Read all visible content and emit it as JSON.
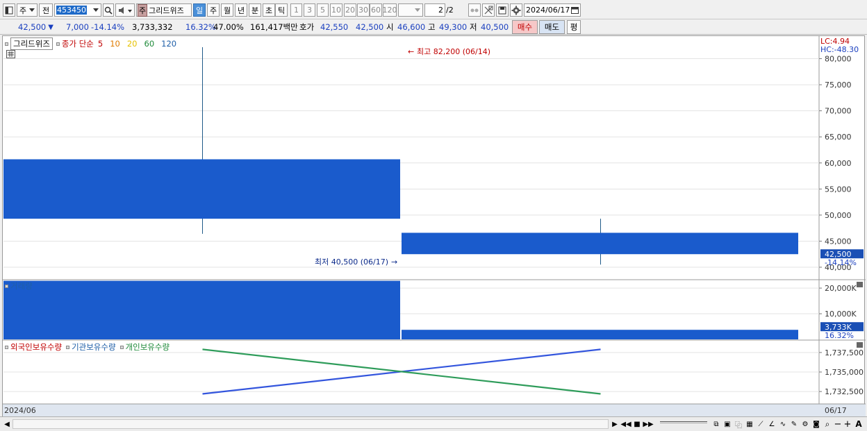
{
  "toolbar": {
    "market_label": "주",
    "prev_label": "전",
    "code_value": "453450",
    "name_prefix": "주",
    "stock_name": "그리드위즈",
    "periods": [
      "일",
      "주",
      "월",
      "년",
      "분",
      "초",
      "틱"
    ],
    "selected_period": "일",
    "intervals": [
      "1",
      "3",
      "5",
      "10",
      "20",
      "30",
      "60",
      "120"
    ],
    "page": "2",
    "page_total": "/2",
    "date_value": "2024/06/17"
  },
  "quote": {
    "price": "42,500",
    "change": "7,000",
    "change_pct": "-14.14%",
    "volume": "3,733,332",
    "volume_pct": "16.32%",
    "ratio": "47.00%",
    "amount": "161,417백만",
    "bid_label": "호가",
    "ask": "42,550",
    "bid": "42,500",
    "open_label": "시",
    "open": "46,600",
    "high_label": "고",
    "high": "49,300",
    "low_label": "저",
    "low": "40,500",
    "buy_label": "매수",
    "sell_label": "매도",
    "avg_label": "평"
  },
  "price_panel": {
    "legend_name": "그리드위즈",
    "ma_label": "종가 단순",
    "ma_periods": [
      {
        "label": "5",
        "color": "#c00000"
      },
      {
        "label": "10",
        "color": "#e07b00"
      },
      {
        "label": "20",
        "color": "#e6c200"
      },
      {
        "label": "60",
        "color": "#1f8a3a"
      },
      {
        "label": "120",
        "color": "#1f5fa8"
      }
    ],
    "lc_label": "LC:4.94",
    "hc_label": "HC:-48.30",
    "high_note": "최고 82,200 (06/14)",
    "low_note": "최저 40,500 (06/17)",
    "current_badge": "42,500",
    "current_pct": "-14.14%",
    "y_ticks": [
      "80,000",
      "75,000",
      "70,000",
      "65,000",
      "60,000",
      "55,000",
      "50,000",
      "45,000",
      "40,000"
    ]
  },
  "volume_panel": {
    "legend": "거래량",
    "y_ticks": [
      "20,000K",
      "10,000K"
    ],
    "current_badge": "3,733K",
    "current_pct": "16.32%"
  },
  "holding_panel": {
    "legend_foreign": "외국인보유수량",
    "legend_inst": "기관보유수량",
    "legend_indiv": "개인보유수량",
    "y_ticks": [
      "1,737,500",
      "1,735,000",
      "1,732,500"
    ]
  },
  "xaxis": {
    "left_label": "2024/06",
    "right_label": "06/17"
  },
  "colors": {
    "candle": "#1a5bcc",
    "volume": "#1a5bcc",
    "inst_line": "#3355dd",
    "indiv_line": "#2e9c5a",
    "high_note": "#c00000",
    "low_note": "#0b2a8a"
  },
  "chart_data": [
    {
      "type": "candlestick",
      "title": "그리드위즈",
      "categories": [
        "06/14",
        "06/17"
      ],
      "open": [
        49300,
        46600
      ],
      "high": [
        82200,
        49300
      ],
      "low": [
        46400,
        40500
      ],
      "close": [
        60700,
        42500
      ],
      "ylim": [
        40000,
        82200
      ]
    },
    {
      "type": "bar",
      "title": "거래량",
      "categories": [
        "06/14",
        "06/17"
      ],
      "values": [
        22840000,
        3733332
      ],
      "ylim": [
        0,
        23000000
      ]
    },
    {
      "type": "line",
      "categories": [
        "06/14",
        "06/17"
      ],
      "series": [
        {
          "name": "기관보유수량",
          "values": [
            1732200,
            1737900
          ]
        },
        {
          "name": "개인보유수량",
          "values": [
            1737900,
            1732200
          ]
        }
      ],
      "ylim": [
        1731000,
        1739000
      ]
    }
  ]
}
